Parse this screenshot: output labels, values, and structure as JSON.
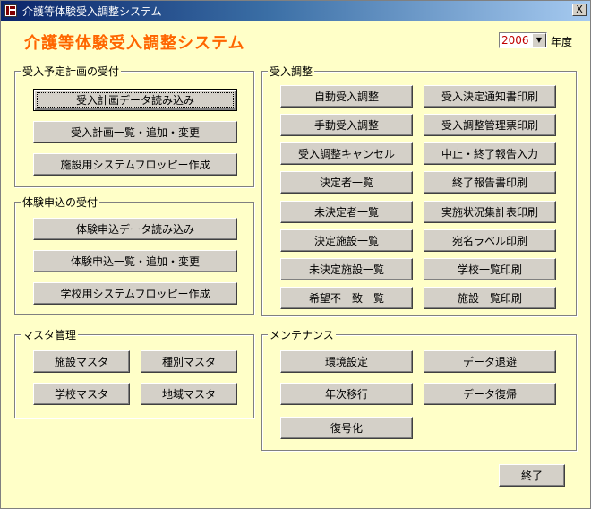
{
  "window": {
    "title": "介護等体験受入調整システム",
    "close_label": "X"
  },
  "header": {
    "app_title": "介護等体験受入調整システム",
    "year_value": "2006",
    "year_label": "年度"
  },
  "groups": {
    "reception_plan": {
      "label": "受入予定計画の受付",
      "buttons": [
        "受入計画データ読み込み",
        "受入計画一覧・追加・変更",
        "施設用システムフロッピー作成"
      ]
    },
    "experience_app": {
      "label": "体験申込の受付",
      "buttons": [
        "体験申込データ読み込み",
        "体験申込一覧・追加・変更",
        "学校用システムフロッピー作成"
      ]
    },
    "master": {
      "label": "マスタ管理",
      "buttons": [
        "施設マスタ",
        "種別マスタ",
        "学校マスタ",
        "地域マスタ"
      ]
    },
    "adjustment": {
      "label": "受入調整",
      "left": [
        "自動受入調整",
        "手動受入調整",
        "受入調整キャンセル",
        "決定者一覧",
        "未決定者一覧",
        "決定施設一覧",
        "未決定施設一覧",
        "希望不一致一覧"
      ],
      "right": [
        "受入決定通知書印刷",
        "受入調整管理票印刷",
        "中止・終了報告入力",
        "終了報告書印刷",
        "実施状況集計表印刷",
        "宛名ラベル印刷",
        "学校一覧印刷",
        "施設一覧印刷"
      ]
    },
    "maintenance": {
      "label": "メンテナンス",
      "buttons": [
        "環境設定",
        "データ退避",
        "年次移行",
        "データ復帰",
        "復号化"
      ]
    }
  },
  "footer": {
    "exit_label": "終了"
  }
}
